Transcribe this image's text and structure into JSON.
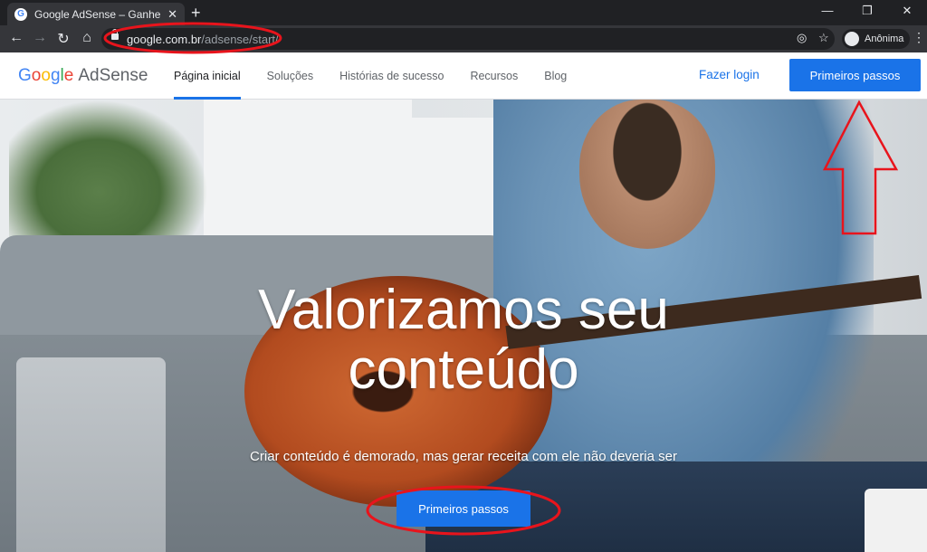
{
  "browser": {
    "tab_title": "Google AdSense – Ganhe dinheiro",
    "tab_favicon": "G",
    "new_tab": "+",
    "url_host": "google.com.br",
    "url_path": "/adsense/start/",
    "profile_label": "Anônima",
    "icons": [
      "back-icon",
      "forward-icon",
      "reload-icon",
      "home-icon",
      "lock-icon",
      "eye-off-icon",
      "star-icon",
      "incognito-icon",
      "menu-icon"
    ]
  },
  "header": {
    "logo_google": [
      "G",
      "o",
      "o",
      "g",
      "l",
      "e"
    ],
    "logo_product": "AdSense",
    "nav": [
      "Página inicial",
      "Soluções",
      "Histórias de sucesso",
      "Recursos",
      "Blog"
    ],
    "login": "Fazer login",
    "cta": "Primeiros passos"
  },
  "hero": {
    "title_line1": "Valorizamos seu",
    "title_line2": "conteúdo",
    "subtitle": "Criar conteúdo é demorado, mas gerar receita com ele não deveria ser",
    "cta": "Primeiros passos"
  },
  "colors": {
    "brand_blue": "#1a73e8",
    "annotation_red": "#e8141c"
  }
}
